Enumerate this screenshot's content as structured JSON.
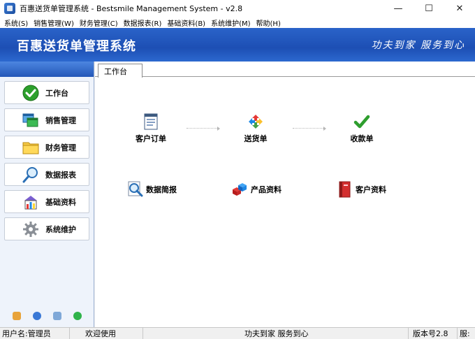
{
  "window": {
    "title": "百惠送货单管理系统 - Bestsmile Management System - v2.8",
    "minimize": "—",
    "maximize": "☐",
    "close": "✕"
  },
  "menu": [
    "系统(S)",
    "销售管理(W)",
    "财务管理(C)",
    "数据报表(R)",
    "基础资料(B)",
    "系统维护(M)",
    "帮助(H)"
  ],
  "banner": {
    "app_name": "百惠送货单管理系统",
    "slogan": "功夫到家 服务到心"
  },
  "sidebar": {
    "items": [
      {
        "label": "工作台",
        "icon": "check-circle-icon"
      },
      {
        "label": "销售管理",
        "icon": "windows-icon"
      },
      {
        "label": "财务管理",
        "icon": "folder-icon"
      },
      {
        "label": "数据报表",
        "icon": "magnifier-icon"
      },
      {
        "label": "基础资料",
        "icon": "building-chart-icon"
      },
      {
        "label": "系统维护",
        "icon": "gear-icon"
      }
    ],
    "tools": [
      "key-icon",
      "clock-icon",
      "search-screen-icon",
      "exit-icon"
    ]
  },
  "tabs": [
    {
      "label": "工作台",
      "active": true
    }
  ],
  "workbench": {
    "flow": [
      {
        "label": "客户订单",
        "icon": "document-icon"
      },
      {
        "label": "送货单",
        "icon": "recycle-arrows-icon"
      },
      {
        "label": "收款单",
        "icon": "green-check-icon"
      }
    ],
    "shortcuts": [
      {
        "label": "数据简报",
        "icon": "report-magnifier-icon"
      },
      {
        "label": "产品资料",
        "icon": "cubes-icon"
      },
      {
        "label": "客户资料",
        "icon": "red-book-icon"
      }
    ]
  },
  "status": {
    "user": "用户名:管理员",
    "welcome": "欢迎使用",
    "slogan": "功夫到家 服务到心",
    "version": "版本号2.8",
    "extra": "服:"
  },
  "colors": {
    "banner": "#1d4fb4",
    "sidebar_bg": "#eef3fb",
    "accent_green": "#2ca02c"
  }
}
